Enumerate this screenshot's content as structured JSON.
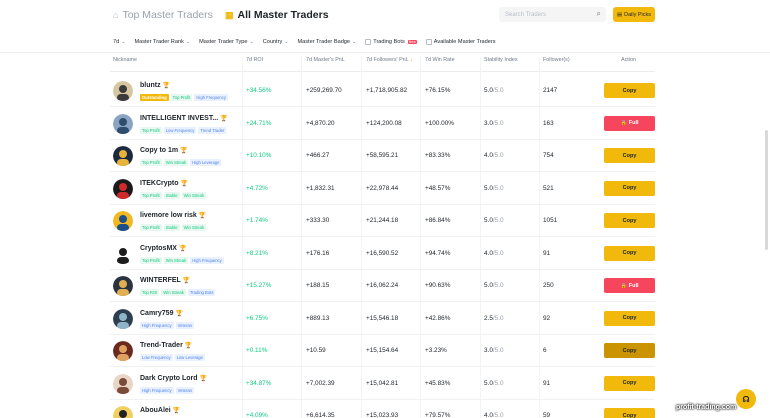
{
  "header": {
    "tab_top": "Top Master Traders",
    "tab_all": "All Master Traders",
    "search_placeholder": "Search Traders",
    "daily_picks": "Daily Picks"
  },
  "filters": {
    "period": "7d",
    "rank": "Master Trader Rank",
    "type": "Master Trader Type",
    "country": "Country",
    "badge": "Master Trader Badge",
    "bots": "Trading Bots",
    "new_badge": "New",
    "available": "Available Master Traders"
  },
  "columns": {
    "nickname": "Nickname",
    "roi": "7d ROI",
    "pnl": "7d Master's PnL",
    "fpnl": "7d Followers' PnL",
    "win": "7d Win Rate",
    "stability": "Stability Index",
    "followers": "Follower(s)",
    "action": "Action"
  },
  "colors": {
    "accent": "#f0b90b",
    "positive": "#0ecb81",
    "danger": "#f6465d"
  },
  "traders": [
    {
      "name": "bluntz",
      "medal": "gold",
      "tags": [
        {
          "t": "Outstanding",
          "c": "orange"
        },
        {
          "t": "Top Profit",
          "c": "green"
        },
        {
          "t": "High Frequency",
          "c": "blue"
        }
      ],
      "roi": "+34.56%",
      "pnl": "+259,269.70",
      "fpnl": "+1,718,905.82",
      "win": "+76.15%",
      "stab": "5.0",
      "stab_max": "/5.0",
      "followers": "2147",
      "action": "Copy",
      "action_type": "copy"
    },
    {
      "name": "INTELLIGENT INVEST...",
      "medal": "bronze",
      "tags": [
        {
          "t": "Top Profit",
          "c": "green"
        },
        {
          "t": "Low Frequency",
          "c": "blue"
        },
        {
          "t": "Trend Trader",
          "c": "blue"
        }
      ],
      "roi": "+24.71%",
      "pnl": "+4,870.20",
      "fpnl": "+124,200.08",
      "win": "+100.00%",
      "stab": "3.0",
      "stab_max": "/5.0",
      "followers": "163",
      "action": "Full",
      "action_type": "full"
    },
    {
      "name": "Copy to 1m",
      "medal": "silver",
      "tags": [
        {
          "t": "Top Profit",
          "c": "green"
        },
        {
          "t": "Win Streak",
          "c": "green"
        },
        {
          "t": "High Leverage",
          "c": "blue"
        }
      ],
      "roi": "+10.10%",
      "pnl": "+466.27",
      "fpnl": "+58,595.21",
      "win": "+83.33%",
      "stab": "4.0",
      "stab_max": "/5.0",
      "followers": "754",
      "action": "Copy",
      "action_type": "copy"
    },
    {
      "name": "ITEKCrypto",
      "medal": "gold",
      "tags": [
        {
          "t": "Top Profit",
          "c": "green"
        },
        {
          "t": "Stable",
          "c": "green"
        },
        {
          "t": "Win Streak",
          "c": "green"
        }
      ],
      "roi": "+4.72%",
      "pnl": "+1,832.31",
      "fpnl": "+22,978.44",
      "win": "+48.57%",
      "stab": "5.0",
      "stab_max": "/5.0",
      "followers": "521",
      "action": "Copy",
      "action_type": "copy"
    },
    {
      "name": "livemore low risk",
      "medal": "gold",
      "tags": [
        {
          "t": "Top Profit",
          "c": "green"
        },
        {
          "t": "Stable",
          "c": "green"
        },
        {
          "t": "Win Streak",
          "c": "green"
        }
      ],
      "roi": "+1.74%",
      "pnl": "+333.30",
      "fpnl": "+21,244.18",
      "win": "+86.84%",
      "stab": "5.0",
      "stab_max": "/5.0",
      "followers": "1051",
      "action": "Copy",
      "action_type": "copy"
    },
    {
      "name": "CryptosMX",
      "medal": "silver",
      "tags": [
        {
          "t": "Top Profit",
          "c": "green"
        },
        {
          "t": "Win Streak",
          "c": "green"
        },
        {
          "t": "High Frequency",
          "c": "blue"
        }
      ],
      "roi": "+8.21%",
      "pnl": "+176.16",
      "fpnl": "+16,590.52",
      "win": "+94.74%",
      "stab": "4.0",
      "stab_max": "/5.0",
      "followers": "91",
      "action": "Copy",
      "action_type": "copy"
    },
    {
      "name": "WINTERFEL",
      "medal": "bronze",
      "tags": [
        {
          "t": "Top ROI",
          "c": "green"
        },
        {
          "t": "Win Streak",
          "c": "green"
        },
        {
          "t": "Trading Bots",
          "c": "blue"
        }
      ],
      "roi": "+15.27%",
      "pnl": "+188.15",
      "fpnl": "+16,062.24",
      "win": "+90.63%",
      "stab": "5.0",
      "stab_max": "/5.0",
      "followers": "250",
      "action": "Full",
      "action_type": "full"
    },
    {
      "name": "Camry759",
      "medal": "bronze",
      "tags": [
        {
          "t": "High Frequency",
          "c": "blue"
        },
        {
          "t": "Veteran",
          "c": "blue"
        }
      ],
      "roi": "+6.75%",
      "pnl": "+889.13",
      "fpnl": "+15,546.18",
      "win": "+42.86%",
      "stab": "2.5",
      "stab_max": "/5.0",
      "followers": "92",
      "action": "Copy",
      "action_type": "copy"
    },
    {
      "name": "Trend-Trader",
      "medal": "bronze",
      "tags": [
        {
          "t": "Low Frequency",
          "c": "blue"
        },
        {
          "t": "Low Leverage",
          "c": "blue"
        }
      ],
      "roi": "+0.11%",
      "pnl": "+10.59",
      "fpnl": "+15,154.64",
      "win": "+3.23%",
      "stab": "3.0",
      "stab_max": "/5.0",
      "followers": "6",
      "action": "Copy",
      "action_type": "hover"
    },
    {
      "name": "Dark Crypto Lord",
      "medal": "gold",
      "tags": [
        {
          "t": "High Frequency",
          "c": "blue"
        },
        {
          "t": "Veteran",
          "c": "blue"
        }
      ],
      "roi": "+34.87%",
      "pnl": "+7,002.39",
      "fpnl": "+15,042.81",
      "win": "+45.83%",
      "stab": "5.0",
      "stab_max": "/5.0",
      "followers": "91",
      "action": "Copy",
      "action_type": "copy"
    },
    {
      "name": "AbouAlei",
      "medal": "gold",
      "tags": [],
      "roi": "+4.09%",
      "pnl": "+6,614.35",
      "fpnl": "+15,023.93",
      "win": "+79.57%",
      "stab": "4.0",
      "stab_max": "/5.0",
      "followers": "59",
      "action": "Copy",
      "action_type": "copy"
    }
  ],
  "watermark": "profit-trading.com"
}
